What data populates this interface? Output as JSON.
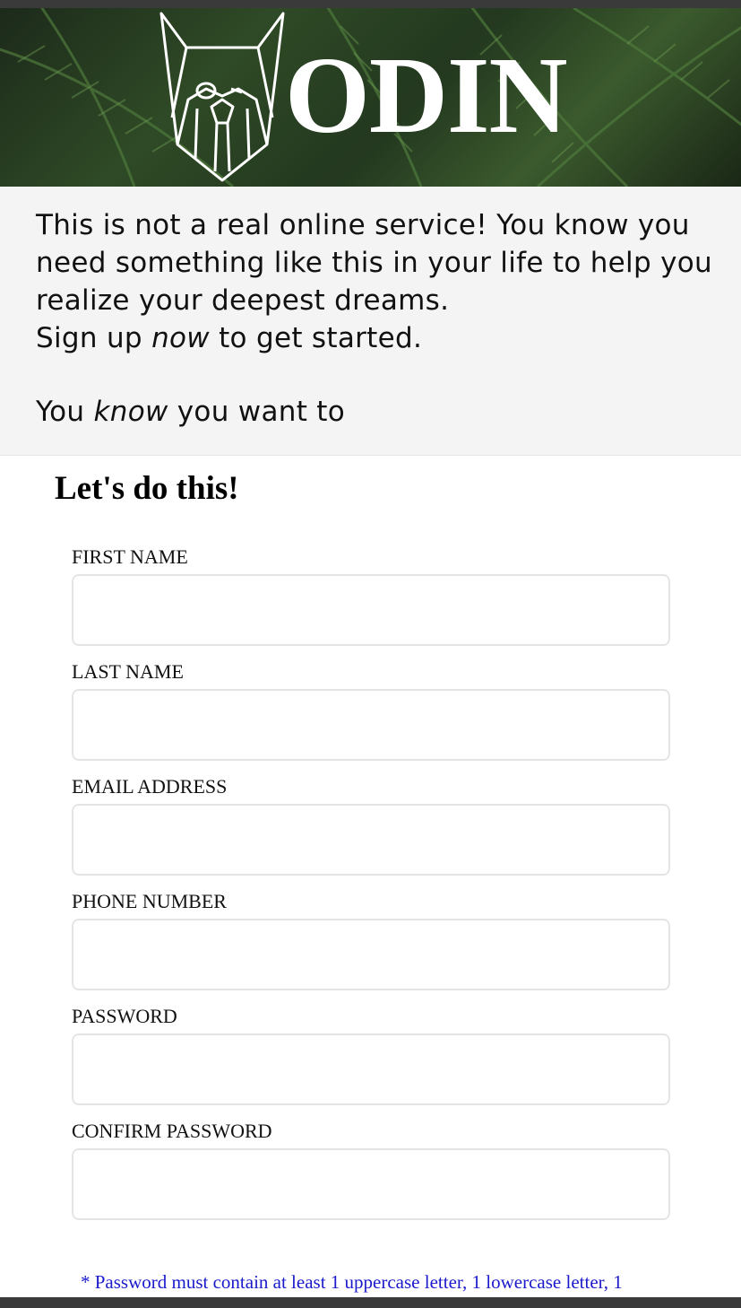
{
  "brand": {
    "name": "ODIN",
    "logo_icon": "viking-bearded-face-icon"
  },
  "intro": {
    "line1": "This is not a real online service! You know you need something like this in your life to help you realize your deepest dreams.",
    "line2_prefix": "Sign up ",
    "line2_emphasis": "now",
    "line2_suffix": " to get started.",
    "line3_prefix": "You ",
    "line3_emphasis": "know",
    "line3_suffix": " you want to"
  },
  "form": {
    "title": "Let's do this!",
    "fields": [
      {
        "label": "FIRST NAME",
        "value": "",
        "placeholder": ""
      },
      {
        "label": "LAST NAME",
        "value": "",
        "placeholder": ""
      },
      {
        "label": "EMAIL ADDRESS",
        "value": "",
        "placeholder": ""
      },
      {
        "label": "PHONE NUMBER",
        "value": "",
        "placeholder": ""
      },
      {
        "label": "PASSWORD",
        "value": "",
        "placeholder": ""
      },
      {
        "label": "CONFIRM PASSWORD",
        "value": "",
        "placeholder": ""
      }
    ],
    "password_note": "* Password must contain at least 1 uppercase letter, 1 lowercase letter, 1"
  },
  "colors": {
    "intro_background": "#f4f4f4",
    "note_text": "#1a1acc",
    "input_border": "#e4e4e4"
  }
}
